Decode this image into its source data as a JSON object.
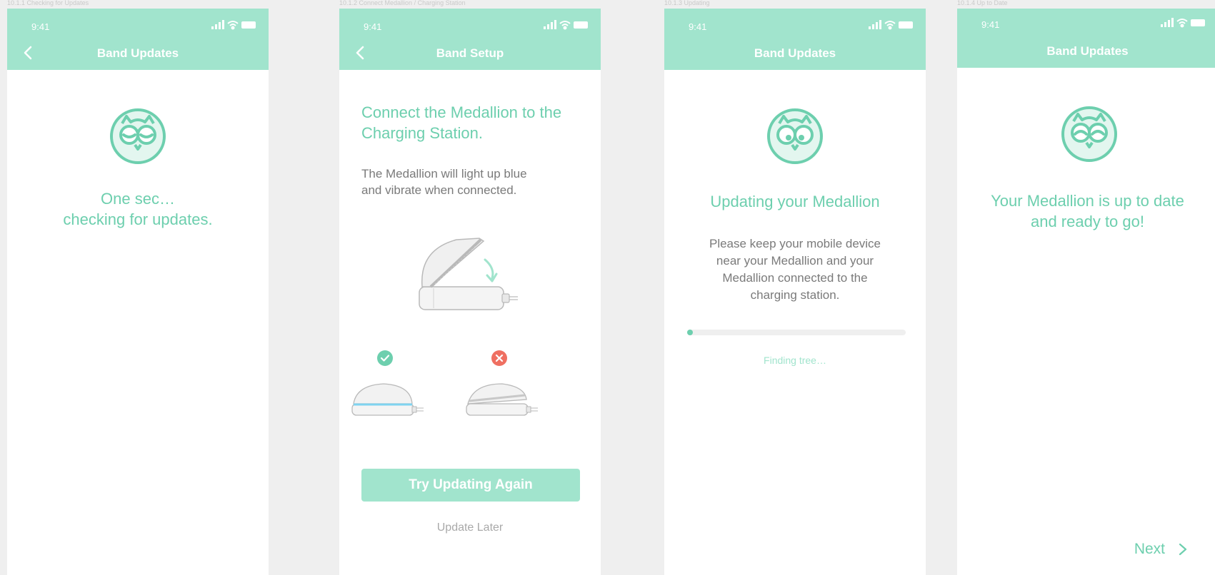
{
  "screens": [
    {
      "caption": "10.1.1 Checking for Updates",
      "status_time": "9:41",
      "nav_title": "Band Updates",
      "message_line1": "One sec…",
      "message_line2": "checking for updates."
    },
    {
      "caption": "10.1.2 Connect Medallion / Charging Station",
      "status_time": "9:41",
      "nav_title": "Band Setup",
      "heading_line1": "Connect the Medallion to the",
      "heading_line2": "Charging Station.",
      "body_line1": "The Medallion will light up blue",
      "body_line2": "and vibrate when connected.",
      "primary_button": "Try Updating Again",
      "secondary_link": "Update Later"
    },
    {
      "caption": "10.1.3 Updating",
      "status_time": "9:41",
      "nav_title": "Band Updates",
      "heading": "Updating your Medallion",
      "body_line1": "Please keep your mobile device",
      "body_line2": "near your Medallion and your",
      "body_line3": "Medallion connected to the",
      "body_line4": "charging station.",
      "progress_value": 0.02,
      "progress_status": "Finding tree…"
    },
    {
      "caption": "10.1.4 Up to Date",
      "status_time": "9:41",
      "nav_title": "Band Updates",
      "message_line1": "Your Medallion is up to date",
      "message_line2": "and ready to go!",
      "next_label": "Next"
    }
  ],
  "colors": {
    "header": "#a1e4cd",
    "accent": "#6dcfae",
    "success": "#6dcfae",
    "error": "#ef6f61",
    "background": "#efefef"
  },
  "icons": [
    "back-chevron-icon",
    "signal-icon",
    "wifi-icon",
    "battery-icon",
    "owl-logo-icon",
    "check-icon",
    "close-icon",
    "chevron-right-icon"
  ]
}
